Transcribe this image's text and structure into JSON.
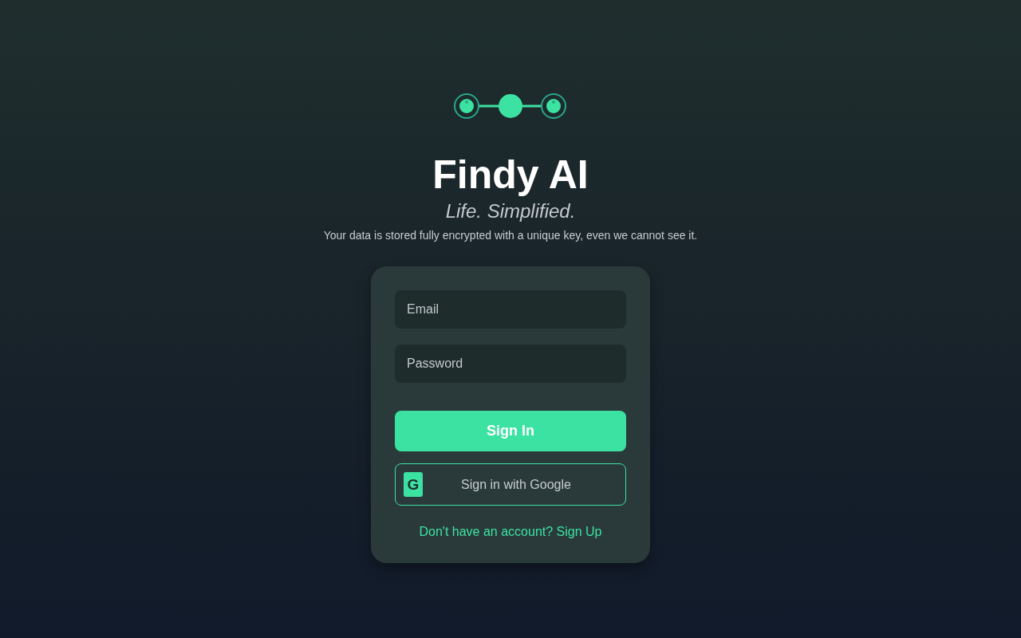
{
  "title": "Findy AI",
  "tagline": "Life. Simplified.",
  "note": "Your data is stored fully encrypted with a unique key, even we cannot see it.",
  "fields": [
    {
      "placeholder": "Email"
    },
    {
      "placeholder": "Password"
    }
  ],
  "sign_in_button": "Sign In",
  "google_button": {
    "icon": "G",
    "label": "Sign in with Google"
  },
  "signup_link": "Don't have an account? Sign Up"
}
